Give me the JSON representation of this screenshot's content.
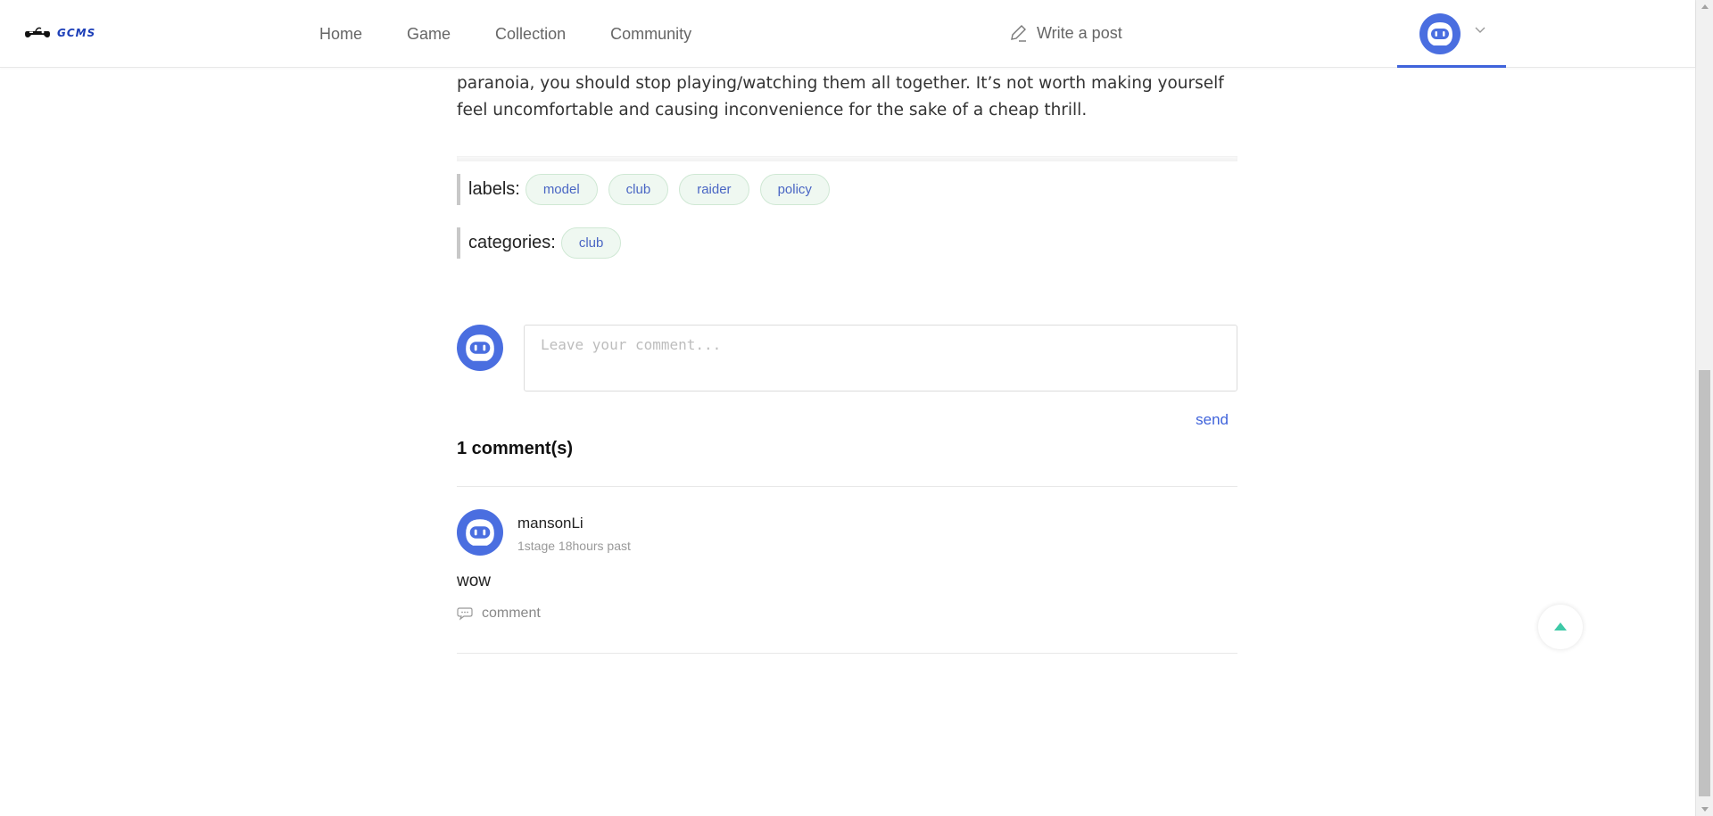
{
  "header": {
    "logo_text": "GCMS",
    "nav": [
      "Home",
      "Game",
      "Collection",
      "Community"
    ],
    "write_label": "Write a post"
  },
  "article": {
    "paragraph_tail": "paranoia, you should stop playing/watching them all together. It’s not worth making yourself feel uncomfortable and causing inconvenience for the sake of a cheap thrill."
  },
  "labels": {
    "title": "labels:",
    "items": [
      "model",
      "club",
      "raider",
      "policy"
    ]
  },
  "categories": {
    "title": "categories:",
    "items": [
      "club"
    ]
  },
  "comment_form": {
    "placeholder": "Leave your comment...",
    "send_label": "send"
  },
  "comments": {
    "count_label": "1 comment(s)",
    "items": [
      {
        "author": "mansonLi",
        "time": "1stage 18hours past",
        "text": "wow",
        "reply_label": "comment"
      }
    ]
  },
  "colors": {
    "accent": "#3f63db",
    "tag_bg": "#eff8f1",
    "tag_border": "#cfe8d4",
    "backtop_arrow": "#3ec9a7"
  },
  "icons": {
    "logo": "gamepad-icon",
    "write": "pen-icon",
    "avatar": "robot-avatar-icon",
    "caret": "chevron-down-icon",
    "reply": "speech-bubble-icon",
    "backtop": "arrow-up-icon"
  }
}
